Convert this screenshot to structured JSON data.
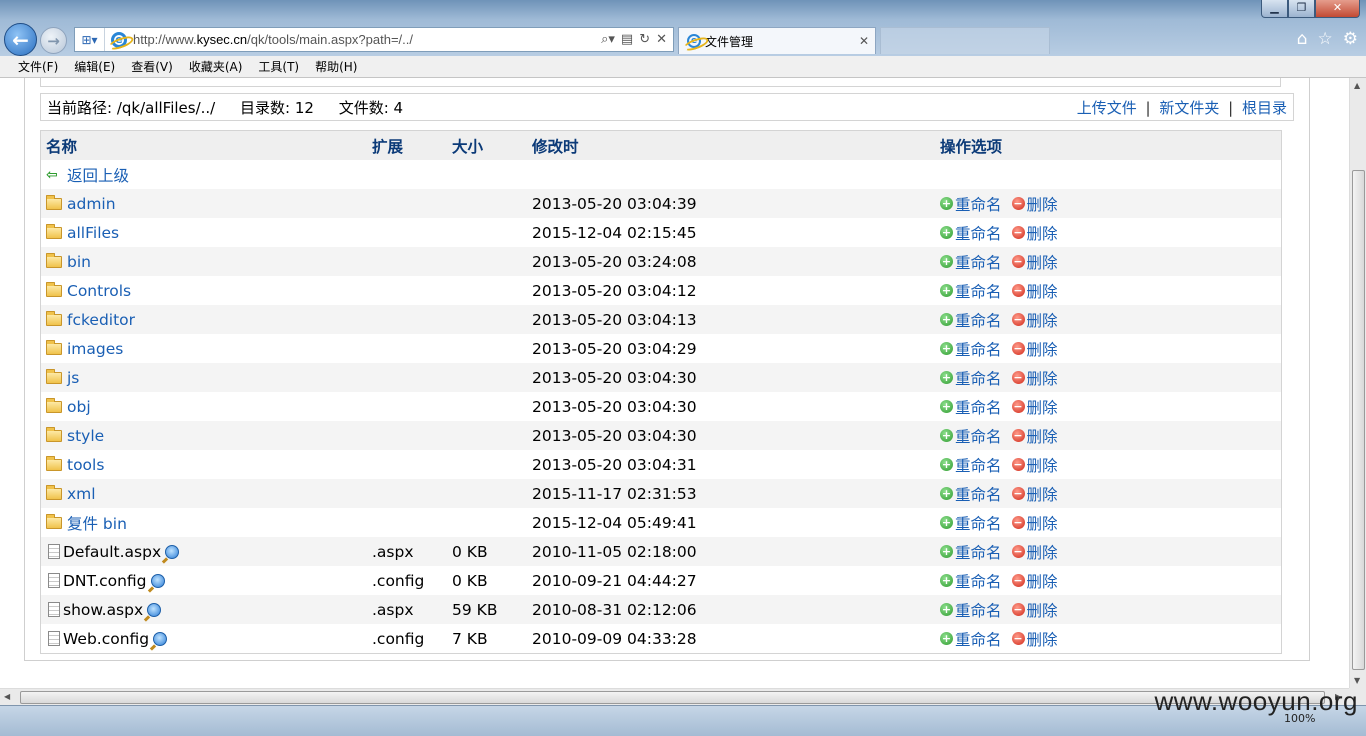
{
  "browser": {
    "address": "http://www.kysec.cn/qk/tools/main.aspx?path=/../",
    "address_prefix": "http://www.",
    "address_domain": "kysec.cn",
    "address_rest": "/qk/tools/main.aspx?path=/../",
    "tab_title": "文件管理",
    "zoom": "100%",
    "menu": [
      "文件(F)",
      "编辑(E)",
      "查看(V)",
      "收藏夹(A)",
      "工具(T)",
      "帮助(H)"
    ]
  },
  "pathbar": {
    "current_path": "当前路径: /qk/allFiles/../",
    "dir_count": "目录数: 12",
    "file_count": "文件数: 4",
    "upload": "上传文件",
    "new_folder": "新文件夹",
    "root": "根目录",
    "sep": "|"
  },
  "table": {
    "headers": {
      "name": "名称",
      "ext": "扩展",
      "size": "大小",
      "modified": "修改时",
      "ops": "操作选项"
    },
    "back": "返回上级",
    "rename": "重命名",
    "delete": "删除",
    "folders": [
      {
        "name": "admin",
        "modified": "2013-05-20 03:04:39"
      },
      {
        "name": "allFiles",
        "modified": "2015-12-04 02:15:45"
      },
      {
        "name": "bin",
        "modified": "2013-05-20 03:24:08"
      },
      {
        "name": "Controls",
        "modified": "2013-05-20 03:04:12"
      },
      {
        "name": "fckeditor",
        "modified": "2013-05-20 03:04:13"
      },
      {
        "name": "images",
        "modified": "2013-05-20 03:04:29"
      },
      {
        "name": "js",
        "modified": "2013-05-20 03:04:30"
      },
      {
        "name": "obj",
        "modified": "2013-05-20 03:04:30"
      },
      {
        "name": "style",
        "modified": "2013-05-20 03:04:30"
      },
      {
        "name": "tools",
        "modified": "2013-05-20 03:04:31"
      },
      {
        "name": "xml",
        "modified": "2015-11-17 02:31:53"
      },
      {
        "name": "复件 bin",
        "modified": "2015-12-04 05:49:41"
      }
    ],
    "files": [
      {
        "name": "Default.aspx",
        "ext": ".aspx",
        "size": "0 KB",
        "modified": "2010-11-05 02:18:00"
      },
      {
        "name": "DNT.config",
        "ext": ".config",
        "size": "0 KB",
        "modified": "2010-09-21 04:44:27"
      },
      {
        "name": "show.aspx",
        "ext": ".aspx",
        "size": "59 KB",
        "modified": "2010-08-31 02:12:06"
      },
      {
        "name": "Web.config",
        "ext": ".config",
        "size": "7 KB",
        "modified": "2010-09-09 04:33:28"
      }
    ]
  },
  "watermark": "www.wooyun.org"
}
